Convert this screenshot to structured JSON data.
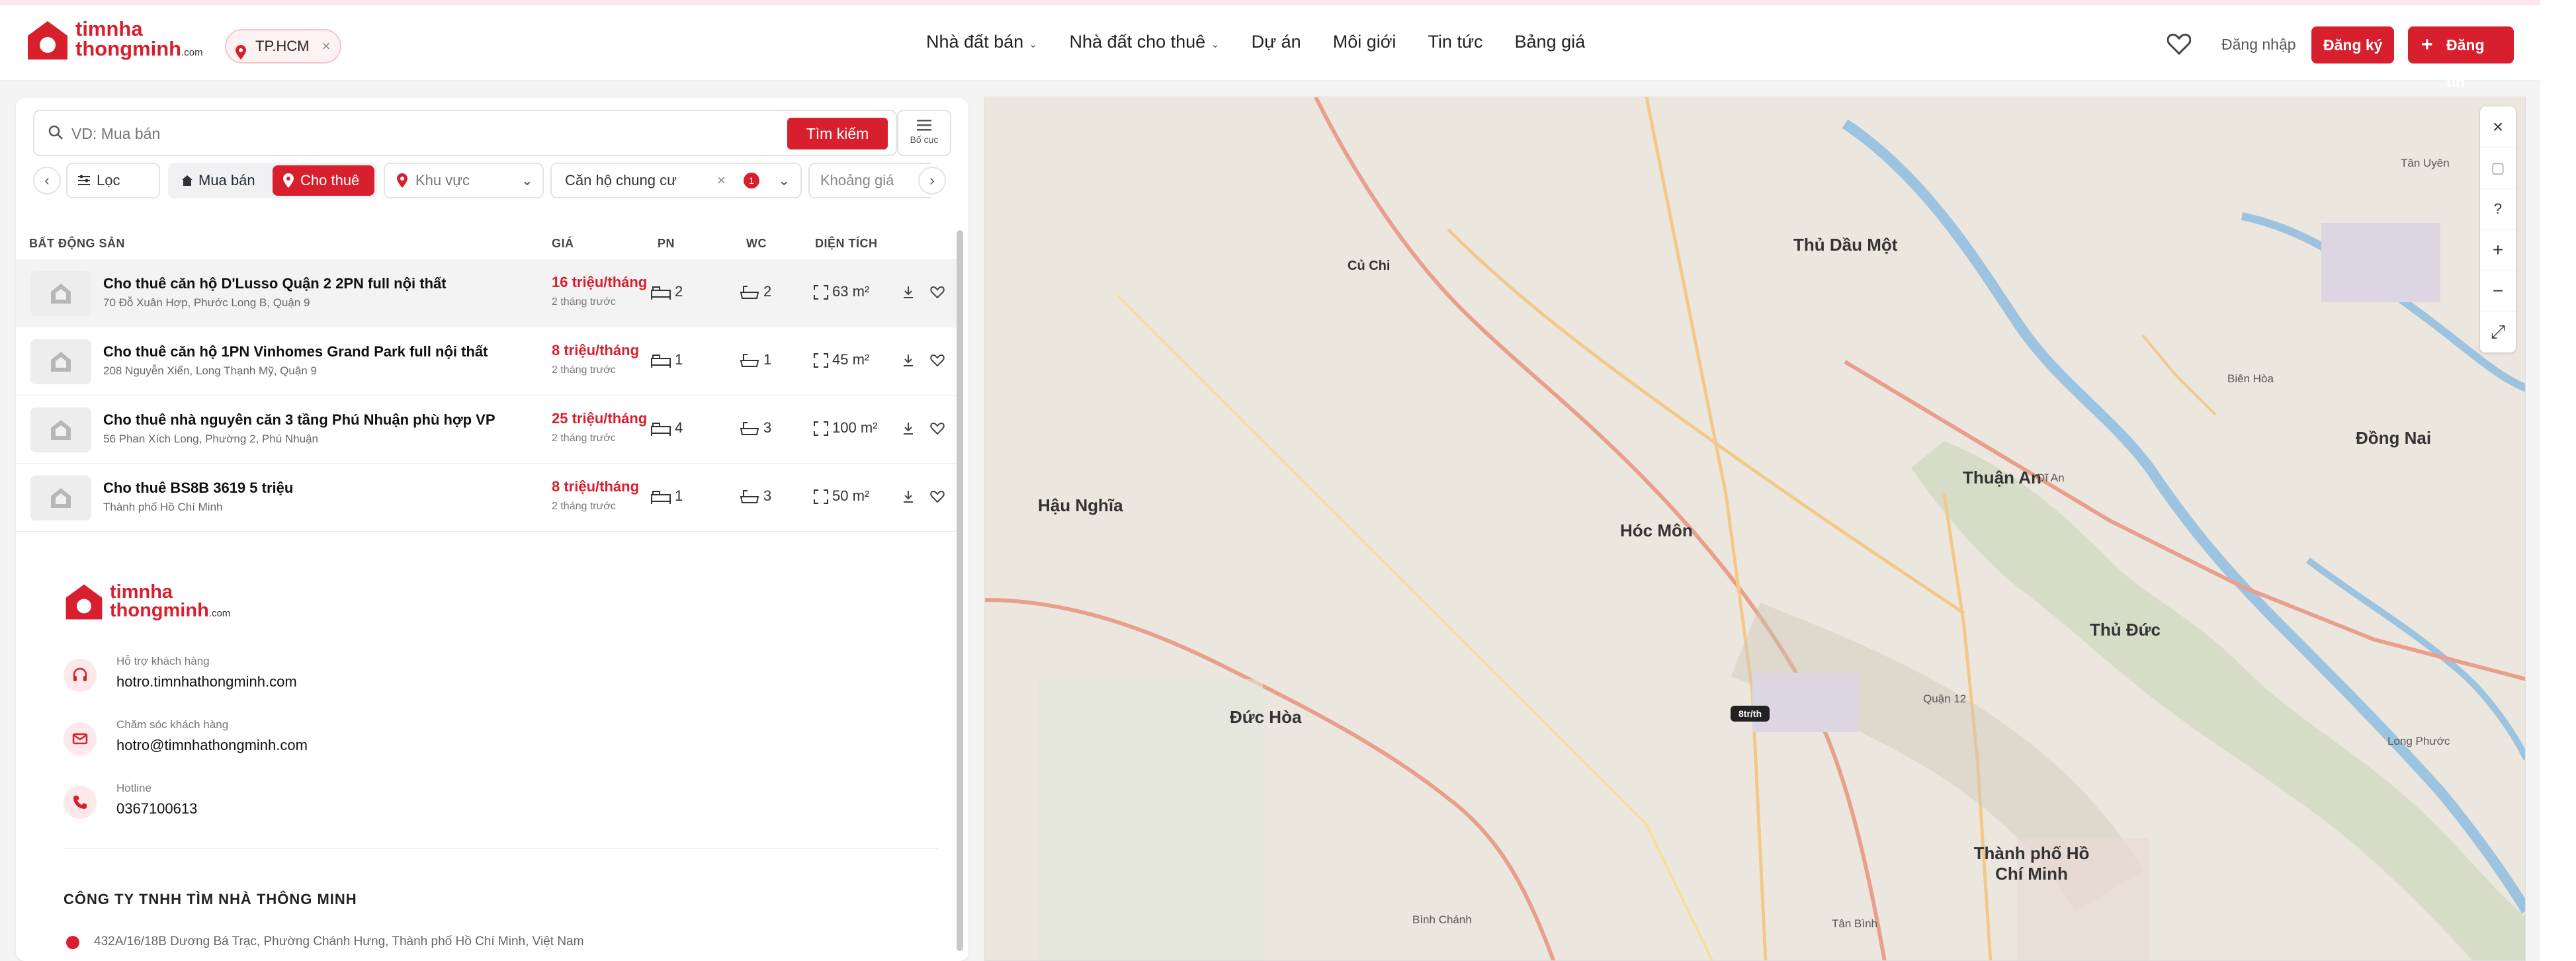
{
  "brand": {
    "name_line1": "timnha",
    "name_line2": "thongminh",
    "suffix": ".com",
    "color": "#d71f2d"
  },
  "city_chip": {
    "label": "TP.HCM",
    "close": "×"
  },
  "nav": [
    {
      "label": "Nhà đất bán",
      "has_dropdown": true
    },
    {
      "label": "Nhà đất cho thuê",
      "has_dropdown": true
    },
    {
      "label": "Dự án",
      "has_dropdown": false
    },
    {
      "label": "Môi giới",
      "has_dropdown": false
    },
    {
      "label": "Tin tức",
      "has_dropdown": false
    },
    {
      "label": "Bảng giá",
      "has_dropdown": false
    }
  ],
  "header_actions": {
    "login": "Đăng nhập",
    "register": "Đăng ký",
    "post": "Đăng tin"
  },
  "search": {
    "placeholder": "VD: Mua bán",
    "button": "Tìm kiếm",
    "layout_label": "Bố cục"
  },
  "filters": {
    "filter_label": "Lọc",
    "sale": "Mua bán",
    "rent": "Cho thuê",
    "area": "Khu vực",
    "property_type": "Căn hộ chung cư",
    "property_type_count": "1",
    "price": "Khoảng giá"
  },
  "table": {
    "headers": {
      "property": "BẤT ĐỘNG SẢN",
      "price": "GIÁ",
      "bedrooms": "PN",
      "bathrooms": "WC",
      "area": "DIỆN TÍCH"
    },
    "rows": [
      {
        "title": "Cho thuê căn hộ D'Lusso Quận 2 2PN full nội thất",
        "address": "70 Đỗ Xuân Hợp, Phước Long B, Quận 9",
        "price": "16 triệu/tháng",
        "time": "2 tháng trước",
        "bedrooms": "2",
        "bathrooms": "2",
        "area": "63 m²"
      },
      {
        "title": "Cho thuê căn hộ 1PN Vinhomes Grand Park full nội thất",
        "address": "208 Nguyễn Xiển, Long Thạnh Mỹ, Quận 9",
        "price": "8 triệu/tháng",
        "time": "2 tháng trước",
        "bedrooms": "1",
        "bathrooms": "1",
        "area": "45 m²"
      },
      {
        "title": "Cho thuê nhà nguyên căn 3 tầng Phú Nhuận phù hợp VP",
        "address": "56 Phan Xích Long, Phường 2, Phú Nhuận",
        "price": "25 triệu/tháng",
        "time": "2 tháng trước",
        "bedrooms": "4",
        "bathrooms": "3",
        "area": "100 m²"
      },
      {
        "title": "Cho thuê BS8B 3619 5 triệu",
        "address": "Thành phố Hồ Chí Minh",
        "price": "8 triệu/tháng",
        "time": "2 tháng trước",
        "bedrooms": "1",
        "bathrooms": "3",
        "area": "50 m²"
      }
    ]
  },
  "footer": {
    "support_label": "Hỗ trợ khách hàng",
    "support_value": "hotro.timnhathongminh.com",
    "care_label": "Chăm sóc khách hàng",
    "care_value": "hotro@timnhathongminh.com",
    "hotline_label": "Hotline",
    "hotline_value": "0367100613",
    "company": "CÔNG TY TNHH TÌM NHÀ THÔNG MINH",
    "address": "432A/16/18B Dương Bá Trạc, Phường Chánh Hưng, Thành phố Hồ Chí Minh, Việt Nam"
  },
  "map": {
    "controls": [
      "×",
      "▢",
      "?",
      "+",
      "−",
      "⤢"
    ],
    "marker": "8tr/th",
    "places": [
      "Thủ Dầu Một",
      "Hóc Môn",
      "Thuận An",
      "Dĩ An",
      "Thủ Đức",
      "Đồng Nai",
      "Hậu Nghĩa",
      "Đức Hòa",
      "Tân Uyên",
      "Tân Bình",
      "Thành phố Hồ Chí Minh",
      "Củ Chi",
      "Biên Hòa",
      "Long Phước",
      "Bình Chánh",
      "Quận 12"
    ]
  }
}
